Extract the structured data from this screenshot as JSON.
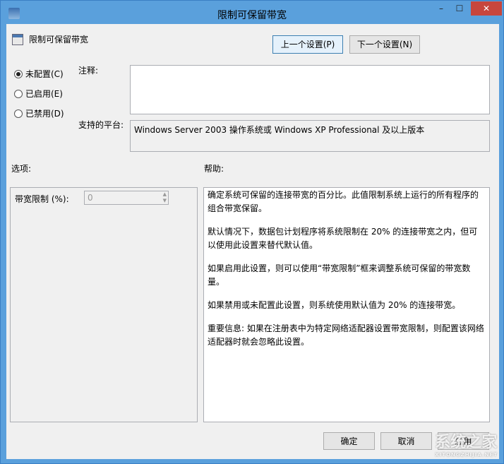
{
  "window": {
    "title": "限制可保留带宽",
    "minimize": "–",
    "maximize": "☐",
    "close": "✕"
  },
  "header": {
    "policy_name": "限制可保留带宽",
    "prev_button": "上一个设置(P)",
    "next_button": "下一个设置(N)"
  },
  "state": {
    "options": [
      {
        "label": "未配置(C)",
        "checked": true
      },
      {
        "label": "已启用(E)",
        "checked": false
      },
      {
        "label": "已禁用(D)",
        "checked": false
      }
    ]
  },
  "comment": {
    "label": "注释:",
    "value": ""
  },
  "platform": {
    "label": "支持的平台:",
    "value": "Windows Server 2003 操作系统或 Windows XP Professional 及以上版本"
  },
  "options_label": "选项:",
  "help_label": "帮助:",
  "bandwidth": {
    "label": "带宽限制 (%):",
    "value": "0"
  },
  "help": [
    "确定系统可保留的连接带宽的百分比。此值限制系统上运行的所有程序的组合带宽保留。",
    "默认情况下，数据包计划程序将系统限制在 20% 的连接带宽之内，但可以使用此设置来替代默认值。",
    "如果启用此设置，则可以使用“带宽限制”框来调整系统可保留的带宽数量。",
    "如果禁用或未配置此设置，则系统使用默认值为 20% 的连接带宽。",
    "重要信息: 如果在注册表中为特定网络适配器设置带宽限制，则配置该网络适配器时就会忽略此设置。"
  ],
  "footer": {
    "ok": "确定",
    "cancel": "取消",
    "apply": "应用"
  },
  "watermark": {
    "text": "系统之家",
    "url": "XITONGZHIJIA.NET"
  }
}
